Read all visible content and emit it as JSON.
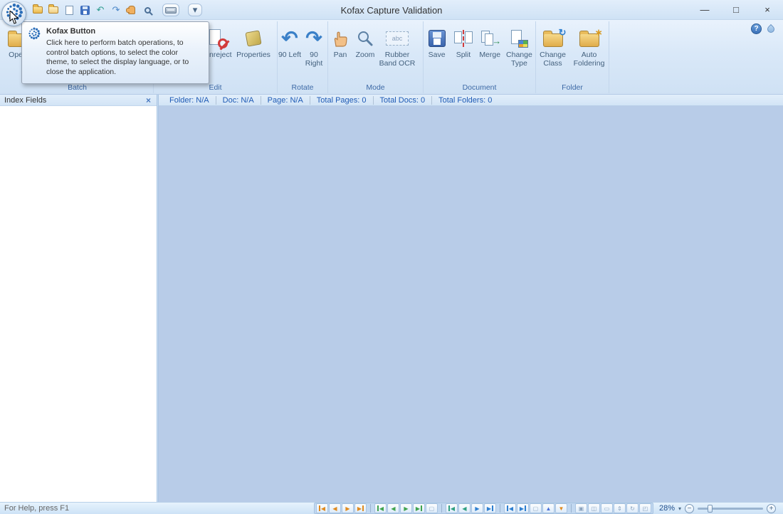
{
  "window": {
    "title": "Kofax Capture Validation",
    "minimize_glyph": "—",
    "maximize_glyph": "□",
    "close_glyph": "×"
  },
  "titlebar": {
    "qat": [
      {
        "name": "qat-open-batch-button",
        "icon": "open-folder",
        "cls": "i-folder"
      },
      {
        "name": "qat-open-image-button",
        "icon": "folder",
        "cls": "i-folder light"
      },
      {
        "name": "qat-print-button",
        "icon": "printer",
        "cls": "i-page"
      },
      {
        "name": "qat-save-button",
        "icon": "floppy-disk",
        "cls": "i-floppy"
      },
      {
        "name": "qat-undo-button",
        "icon": "undo-arrow",
        "g": "↶",
        "c": "#2e9c8e"
      },
      {
        "name": "qat-redo-button",
        "icon": "redo-arrow",
        "g": "↷",
        "c": "#4a86c8"
      },
      {
        "name": "qat-pan-button",
        "icon": "hand",
        "cls": "i-hand"
      },
      {
        "name": "qat-zoom-button",
        "icon": "magnifier",
        "cls": "i-mag"
      },
      {
        "name": "qat-scan-button",
        "icon": "scanner",
        "cls": "i-scan",
        "gap": true
      },
      {
        "name": "qat-more-button",
        "icon": "chevron-down",
        "g": "▾",
        "c": "#4a6888",
        "gap": true
      }
    ]
  },
  "kofax": {
    "tooltip_title": "Kofax Button",
    "tooltip_body": "Click here to perform batch operations, to control batch options, to select the color theme, to select the display language, or to close the application."
  },
  "ribbon": {
    "groups": [
      {
        "label": "Batch"
      },
      {
        "label": "Edit"
      },
      {
        "label": "Rotate"
      },
      {
        "label": "Mode"
      },
      {
        "label": "Document"
      },
      {
        "label": "Folder"
      }
    ],
    "buttons": {
      "open": "Open",
      "unreject": "Unreject",
      "properties": "Properties",
      "rotate_left": "90 Left",
      "rotate_right": "90 Right",
      "pan": "Pan",
      "zoom": "Zoom",
      "rubber_band_ocr": "Rubber Band OCR",
      "save": "Save",
      "split": "Split",
      "merge": "Merge",
      "change_type": "Change Type",
      "change_class": "Change Class",
      "auto_foldering": "Auto Foldering"
    },
    "ocr_sample": "abc",
    "rotate_left_glyph": "↶",
    "rotate_right_glyph": "↷",
    "merge_arrow_glyph": "→",
    "refresh_glyph": "↻",
    "star_glyph": "∗",
    "help_glyph": "?"
  },
  "index_panel": {
    "title": "Index Fields",
    "close_glyph": "×"
  },
  "info_bar": {
    "items": [
      "Folder: N/A",
      "Doc: N/A",
      "Page: N/A",
      "Total Pages: 0",
      "Total Docs: 0",
      "Total Folders: 0"
    ]
  },
  "status_bar": {
    "help_text": "For Help, press F1",
    "zoom_value": "28%",
    "zoom_caret": "▾",
    "zoom_out_glyph": "−",
    "zoom_in_glyph": "+",
    "nav": [
      {
        "name": "first-rejected-button",
        "g": "◀",
        "bar": "l",
        "c": "#e08a1e"
      },
      {
        "name": "prev-rejected-button",
        "g": "◀",
        "c": "#e08a1e"
      },
      {
        "name": "next-rejected-button",
        "g": "▶",
        "c": "#e08a1e"
      },
      {
        "name": "last-rejected-button",
        "g": "▶",
        "bar": "r",
        "c": "#e08a1e"
      },
      {
        "sep": true
      },
      {
        "name": "first-page-button",
        "g": "◀",
        "bar": "l",
        "c": "#3fa34d"
      },
      {
        "name": "prev-page-button",
        "g": "◀",
        "c": "#3fa34d"
      },
      {
        "name": "next-page-button",
        "g": "▶",
        "c": "#3fa34d"
      },
      {
        "name": "last-page-button",
        "g": "▶",
        "bar": "r",
        "c": "#3fa34d"
      },
      {
        "name": "page-thumbnails-button",
        "g": "▢",
        "c": "#98aec6"
      },
      {
        "sep": true
      },
      {
        "name": "first-document-button",
        "g": "◀",
        "bar": "l",
        "c": "#2f9f7f"
      },
      {
        "name": "prev-document-button",
        "g": "◀",
        "c": "#2f9f7f"
      },
      {
        "name": "next-document-button",
        "g": "▶",
        "c": "#2e7fd0"
      },
      {
        "name": "last-document-button",
        "g": "▶",
        "bar": "r",
        "c": "#2e7fd0"
      },
      {
        "sep": true
      },
      {
        "name": "first-folder-button",
        "g": "◀",
        "bar": "l",
        "c": "#2e7fd0"
      },
      {
        "name": "last-folder-button",
        "g": "▶",
        "bar": "r",
        "c": "#2e7fd0"
      },
      {
        "name": "folder-contents-button",
        "g": "▢",
        "c": "#98aec6"
      },
      {
        "name": "go-up-level-button",
        "g": "▲",
        "c": "#4a6fd8"
      },
      {
        "name": "go-down-level-button",
        "g": "▼",
        "c": "#e08a1e"
      },
      {
        "sep": true
      },
      {
        "name": "fit-page-button",
        "g": "▣",
        "c": "#8aa2bd"
      },
      {
        "name": "fit-width-button",
        "g": "◫",
        "c": "#8aa2bd"
      },
      {
        "name": "actual-size-button",
        "g": "▭",
        "c": "#8aa2bd"
      },
      {
        "name": "fit-height-button",
        "g": "⇕",
        "c": "#8aa2bd"
      },
      {
        "name": "rotate-view-button",
        "g": "↻",
        "c": "#8aa2bd"
      },
      {
        "name": "zoom-window-button",
        "g": "◰",
        "c": "#8aa2bd"
      }
    ]
  }
}
